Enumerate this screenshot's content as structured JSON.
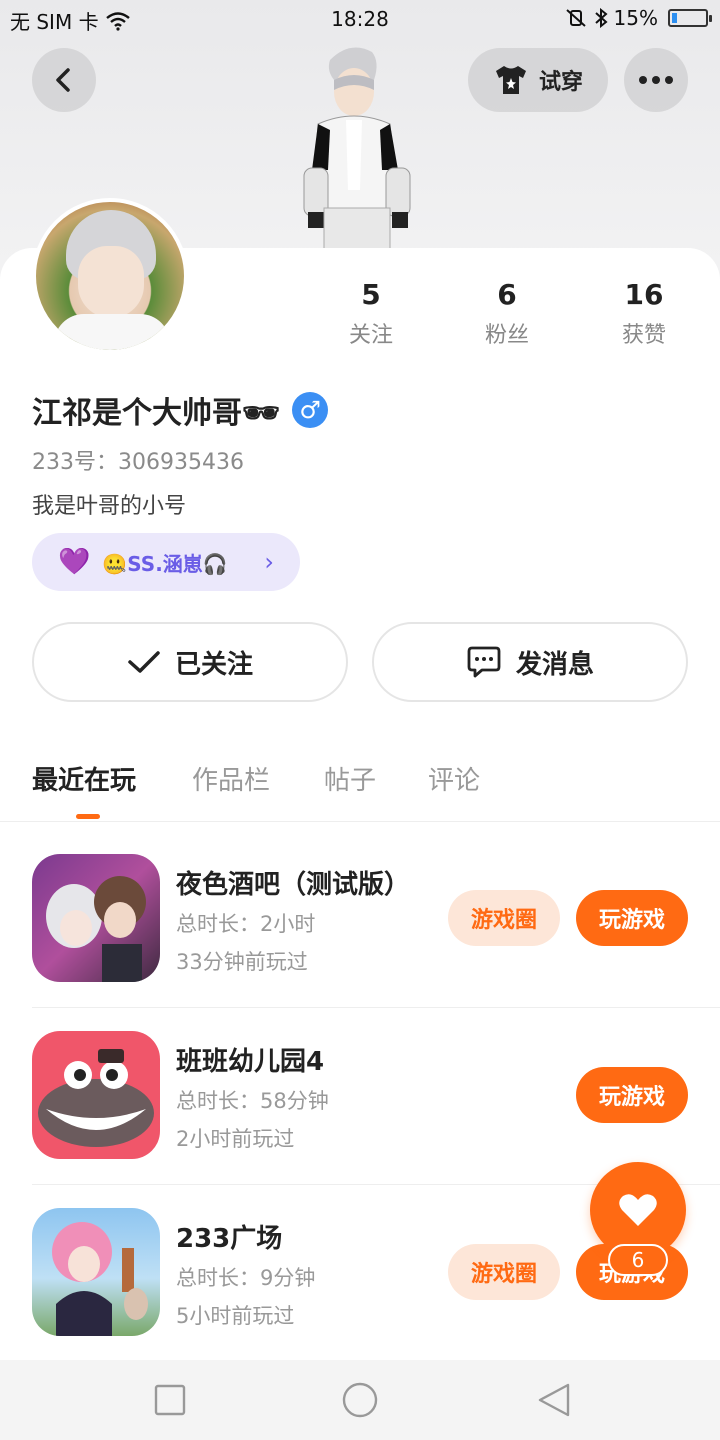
{
  "status_bar": {
    "carrier": "无 SIM 卡",
    "time": "18:28",
    "battery": "15%",
    "battery_level": 0.15
  },
  "header": {
    "try_on_label": "试穿",
    "icons": [
      "back-arrow-icon",
      "tshirt-icon",
      "more-icon"
    ]
  },
  "profile": {
    "stats": [
      {
        "value": "5",
        "label": "关注"
      },
      {
        "value": "6",
        "label": "粉丝"
      },
      {
        "value": "16",
        "label": "获赞"
      }
    ],
    "name": "江祁是个大帅哥🕶",
    "gender_symbol": "♂",
    "gender_color": "#3b8ff4",
    "uid": "233号：306935436",
    "bio": "我是叶哥的小号",
    "friend_chip": "🤐SS.涵崽🎧"
  },
  "actions": {
    "followed_label": "已关注",
    "message_label": "发消息"
  },
  "tabs": [
    {
      "label": "最近在玩",
      "active": true
    },
    {
      "label": "作品栏",
      "active": false
    },
    {
      "label": "帖子",
      "active": false
    },
    {
      "label": "评论",
      "active": false
    }
  ],
  "games": [
    {
      "title": "夜色酒吧（测试版）",
      "time": "总时长：2小时",
      "last": "33分钟前玩过",
      "circle": "游戏圈",
      "play": "玩游戏"
    },
    {
      "title": "班班幼儿园4",
      "time": "总时长：58分钟",
      "last": "2小时前玩过",
      "play": "玩游戏"
    },
    {
      "title": "233广场",
      "time": "总时长：9分钟",
      "last": "5小时前玩过",
      "circle": "游戏圈",
      "play": "玩游戏"
    }
  ],
  "like_fab": {
    "count": "6"
  },
  "accent_color": "#ff6a13"
}
